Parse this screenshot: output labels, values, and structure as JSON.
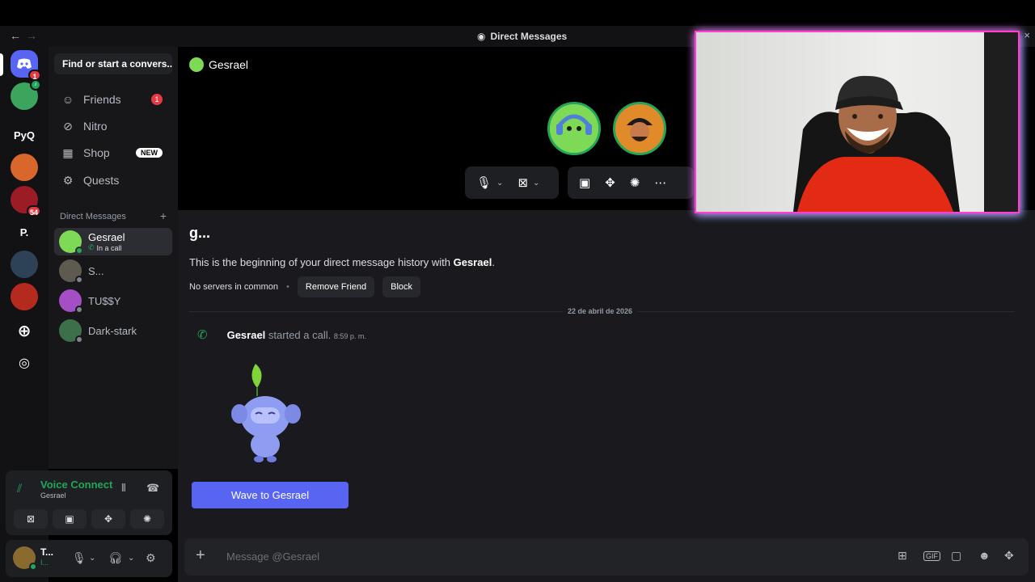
{
  "titlebar": {
    "nav_back": "←",
    "nav_fwd": "→",
    "title": "Direct Messages",
    "close": "×"
  },
  "servers": [
    {
      "label": "",
      "badge": "1",
      "color": "#5865f2"
    },
    {
      "label": "",
      "badge": "",
      "color": "#3ba55d"
    },
    {
      "label": "PyQ",
      "badge": "",
      "color": "#121214"
    },
    {
      "label": "",
      "badge": "",
      "color": "#d9662a"
    },
    {
      "label": "",
      "badge": "54",
      "color": "#9b1c24"
    },
    {
      "label": "P.",
      "badge": "",
      "color": "#121214"
    },
    {
      "label": "",
      "badge": "",
      "color": "#2e4257"
    },
    {
      "label": "",
      "badge": "",
      "color": "#b52a1e"
    }
  ],
  "sidebar": {
    "search_placeholder": "Find or start a convers...",
    "nav": [
      {
        "label": "Friends",
        "badge": "1"
      },
      {
        "label": "Nitro"
      },
      {
        "label": "Shop",
        "tag": "NEW"
      },
      {
        "label": "Quests"
      }
    ],
    "dm_header": "Direct Messages",
    "dm_add": "+",
    "dms": [
      {
        "name": "Gesrael",
        "status": "In a call"
      },
      {
        "name": "S..."
      },
      {
        "name": "TU$$Y"
      },
      {
        "name": "Dark-stark"
      }
    ]
  },
  "voice": {
    "title": "Voice Connected",
    "channel": "Gesrael"
  },
  "user": {
    "name": "T...",
    "status": "I..."
  },
  "call": {
    "name": "Gesrael"
  },
  "history": {
    "title": "g...",
    "text_prefix": "This is the beginning of your direct message history with ",
    "text_name": "Gesrael",
    "text_suffix": ".",
    "no_servers": "No servers in common",
    "remove_friend": "Remove Friend",
    "block": "Block"
  },
  "date_divider": "22 de abril de 2026",
  "message": {
    "author": "Gesrael",
    "text": "started a call.",
    "time": "8:59 p. m."
  },
  "wave_button": "Wave to Gesrael",
  "composer": {
    "placeholder": "Message @Gesrael"
  },
  "colors": {
    "accent": "#5865f2",
    "online": "#23a55a",
    "danger": "#e53a44"
  }
}
